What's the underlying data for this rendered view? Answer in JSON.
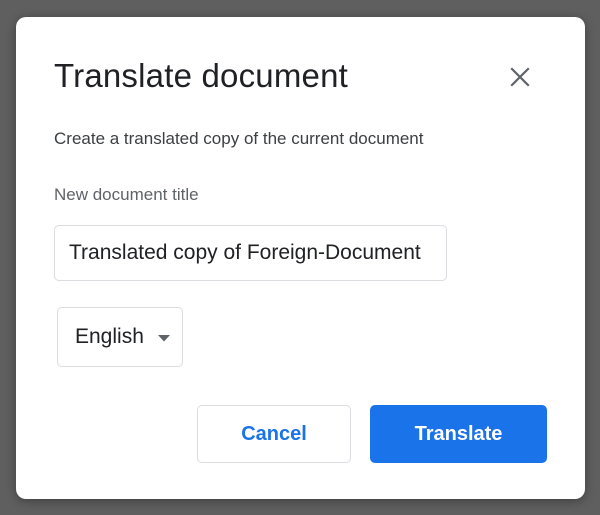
{
  "dialog": {
    "title": "Translate document",
    "description": "Create a translated copy of the current document",
    "title_field_label": "New document title",
    "title_field_value": "Translated copy of Foreign-Document",
    "language_selected": "English",
    "cancel_label": "Cancel",
    "translate_label": "Translate"
  },
  "colors": {
    "accent": "#1a73e8",
    "overlay": "#5f5f5f",
    "border": "#dadce0"
  },
  "icons": {
    "close": "close-icon",
    "dropdown": "caret-down-icon"
  }
}
